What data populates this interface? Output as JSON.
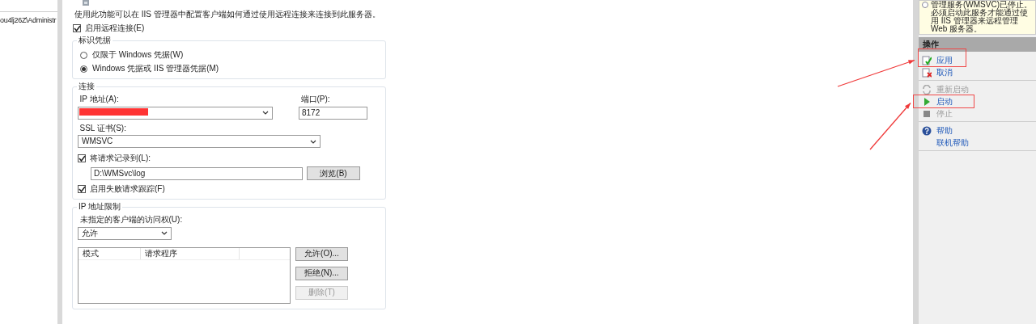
{
  "navigation_tree": {
    "items": [
      {
        "label": "ou4lj26Z\\Administr"
      }
    ]
  },
  "description": "使用此功能可以在 IIS 管理器中配置客户端如何通过使用远程连接来连接到此服务器。",
  "enable_remote": {
    "label": "启用远程连接(E)",
    "checked": true
  },
  "identity_credentials": {
    "title": "标识凭据",
    "options": [
      {
        "label": "仅限于 Windows 凭据(W)",
        "selected": false
      },
      {
        "label": "Windows 凭据或 IIS 管理器凭据(M)",
        "selected": true
      }
    ]
  },
  "connection": {
    "title": "连接",
    "ip_label": "IP 地址(A):",
    "ip_redacted": true,
    "port_label": "端口(P):",
    "port_value": "8172",
    "ssl_label": "SSL 证书(S):",
    "ssl_value": "WMSVC",
    "log_request": {
      "label": "将请求记录到(L):",
      "checked": true
    },
    "log_path": "D:\\WMSvc\\log",
    "browse_button": "浏览(B)",
    "failed_trace": {
      "label": "启用失败请求跟踪(F)",
      "checked": true
    }
  },
  "ip_restrictions": {
    "title": "IP 地址限制",
    "access_label": "未指定的客户端的访问权(U):",
    "access_value": "允许",
    "columns": [
      "模式",
      "请求程序"
    ],
    "buttons": [
      {
        "label": "允许(O)...",
        "disabled": false
      },
      {
        "label": "拒绝(N)...",
        "disabled": false
      },
      {
        "label": "删除(T)",
        "disabled": true
      }
    ]
  },
  "alert": {
    "lines": [
      "管理服务(WMSVC)已停止。",
      "必须启动此服务才能通过使",
      "用 IIS 管理器来远程管理",
      "Web 服务器。"
    ]
  },
  "actions": {
    "title": "操作",
    "groups": [
      [
        {
          "kind": "apply",
          "label": "应用",
          "disabled": false,
          "highlighted": true
        },
        {
          "kind": "cancel",
          "label": "取消",
          "disabled": false,
          "highlighted": false
        }
      ],
      [
        {
          "kind": "restart",
          "label": "重新启动",
          "disabled": true,
          "highlighted": false
        },
        {
          "kind": "start",
          "label": "启动",
          "disabled": false,
          "highlighted": true
        },
        {
          "kind": "stop",
          "label": "停止",
          "disabled": true,
          "highlighted": false
        }
      ],
      [
        {
          "kind": "help",
          "label": "帮助",
          "disabled": false,
          "highlighted": false
        },
        {
          "kind": "online-help",
          "label": "联机帮助",
          "disabled": false,
          "highlighted": false
        }
      ]
    ]
  }
}
